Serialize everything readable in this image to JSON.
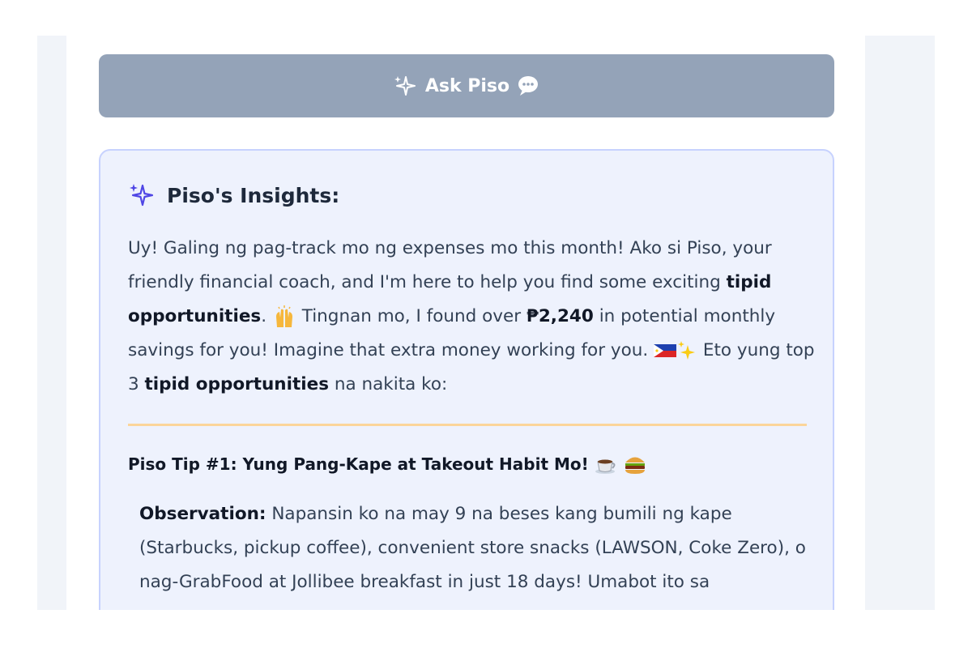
{
  "ask_button": {
    "label": "Ask Piso",
    "sparkle_icon": "sparkles-icon",
    "chat_icon": "speech-bubble-icon"
  },
  "insights": {
    "title": "Piso's Insights:",
    "intro": {
      "p1": "Uy! Galing ng pag-track mo ng expenses mo this month! Ako si Piso, your friendly financial coach, and I'm here to help you find some exciting ",
      "b1": "tipid opportunities",
      "p2": ". ",
      "p3": " Tingnan mo, I found over ",
      "b2": "₱2,240",
      "p4": " in potential monthly savings for you! Imagine that extra money working for you. ",
      "p5": " Eto yung top 3 ",
      "b3": "tipid opportunities",
      "p6": " na nakita ko:"
    },
    "tip1": {
      "title": "Piso Tip #1: Yung Pang-Kape at Takeout Habit Mo!",
      "observation_label": "Observation:",
      "observation_text": " Napansin ko na may 9 na beses kang bumili ng kape (Starbucks, pickup coffee), convenient store snacks (LAWSON, Coke Zero), o nag-GrabFood at Jollibee breakfast in just 18 days! Umabot ito sa"
    }
  },
  "colors": {
    "button_bg": "#94a3b8",
    "card_bg": "#eef2fd",
    "card_border": "#c7d2fe",
    "divider": "#fbd59a",
    "accent_icon": "#4f46e5"
  }
}
